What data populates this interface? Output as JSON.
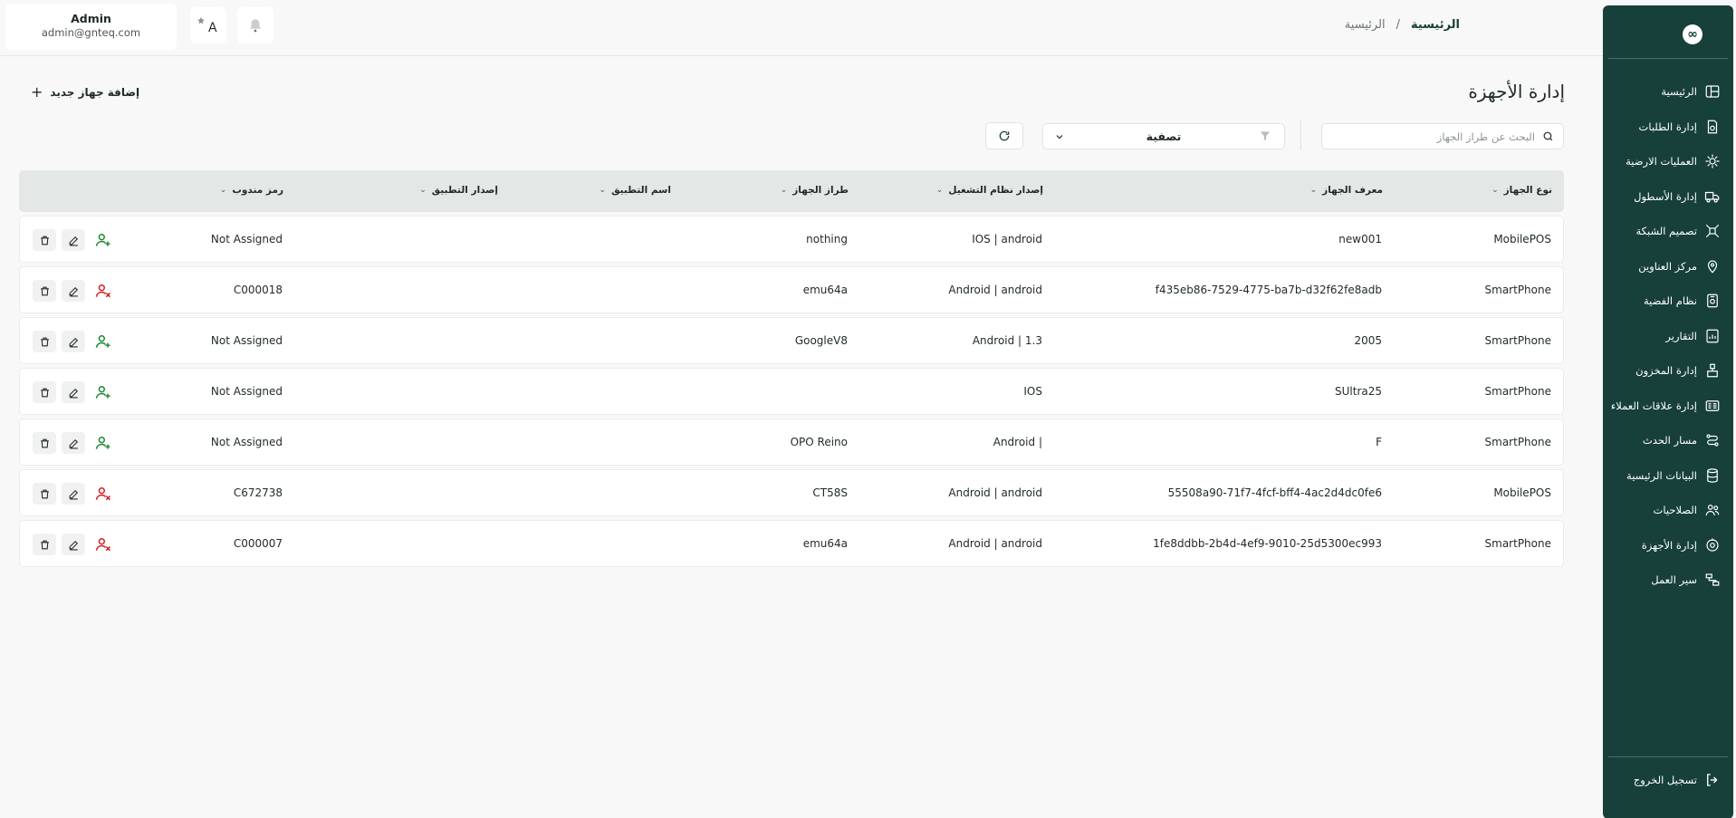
{
  "header": {
    "user": {
      "name": "Admin",
      "email": "admin@gnteq.com"
    },
    "lang_label": "A",
    "breadcrumb": {
      "current": "الرئيسية",
      "separator": "/",
      "link": "الرئيسية"
    }
  },
  "sidebar": {
    "logo": "∞",
    "items": [
      {
        "label": "الرئيسية",
        "icon": "layout-icon"
      },
      {
        "label": "إدارة الطلبات",
        "icon": "orders-icon"
      },
      {
        "label": "العمليات الارضية",
        "icon": "ground-operations-icon"
      },
      {
        "label": "إدارة الأسطول",
        "icon": "truck-icon"
      },
      {
        "label": "تصميم الشبكة",
        "icon": "network-icon"
      },
      {
        "label": "مركز العناوين",
        "icon": "location-pin-icon"
      },
      {
        "label": "نظام الفضية",
        "icon": "case-system-icon"
      },
      {
        "label": "التقارير",
        "icon": "report-icon"
      },
      {
        "label": "إدارة المخزون",
        "icon": "inventory-icon"
      },
      {
        "label": "إدارة علاقات العملاء",
        "icon": "crm-icon"
      },
      {
        "label": "مسار الحدث",
        "icon": "route-icon"
      },
      {
        "label": "البيانات الرئيسية",
        "icon": "database-icon"
      },
      {
        "label": "الصلاحيات",
        "icon": "users-icon"
      },
      {
        "label": "إدارة الأجهزة",
        "icon": "device-icon"
      },
      {
        "label": "سير العمل",
        "icon": "workflow-icon"
      }
    ],
    "logout_label": "تسجيل الخروج"
  },
  "page": {
    "title": "إدارة الأجهزة",
    "add_button": "إضافة جهاز جديد",
    "search_placeholder": "البحث عن طراز الجهاز",
    "filter_label": "تصفية"
  },
  "table": {
    "columns": [
      "نوع الجهاز",
      "معرف الجهاز",
      "إصدار نظام التشغيل",
      "طراز الجهاز",
      "اسم التطبيق",
      "إصدار التطبيق",
      "رمز مندوب"
    ],
    "rows": [
      {
        "type": "MobilePOS",
        "id": "new001",
        "os": "IOS | android",
        "model": "nothing",
        "app": "",
        "version": "",
        "rep": "Not Assigned",
        "assigned": false
      },
      {
        "type": "SmartPhone",
        "id": "f435eb86-7529-4775-ba7b-d32f62fe8adb",
        "os": "Android | android",
        "model": "emu64a",
        "app": "",
        "version": "",
        "rep": "C000018",
        "assigned": true
      },
      {
        "type": "SmartPhone",
        "id": "2005",
        "os": "Android | 1.3",
        "model": "GoogleV8",
        "app": "",
        "version": "",
        "rep": "Not Assigned",
        "assigned": false
      },
      {
        "type": "SmartPhone",
        "id": "SUltra25",
        "os": "IOS",
        "model": "",
        "app": "",
        "version": "",
        "rep": "Not Assigned",
        "assigned": false
      },
      {
        "type": "SmartPhone",
        "id": "F",
        "os": "Android |",
        "model": "OPO Reino",
        "app": "",
        "version": "",
        "rep": "Not Assigned",
        "assigned": false
      },
      {
        "type": "MobilePOS",
        "id": "55508a90-71f7-4fcf-bff4-4ac2d4dc0fe6",
        "os": "Android | android",
        "model": "CT58S",
        "app": "",
        "version": "",
        "rep": "C672738",
        "assigned": true
      },
      {
        "type": "SmartPhone",
        "id": "1fe8ddbb-2b4d-4ef9-9010-25d5300ec993",
        "os": "Android | android",
        "model": "emu64a",
        "app": "",
        "version": "",
        "rep": "C000007",
        "assigned": true
      }
    ]
  },
  "colors": {
    "sidebar": "#17403a",
    "assign": "#1a8a2f",
    "unassign": "#d11f1f"
  }
}
